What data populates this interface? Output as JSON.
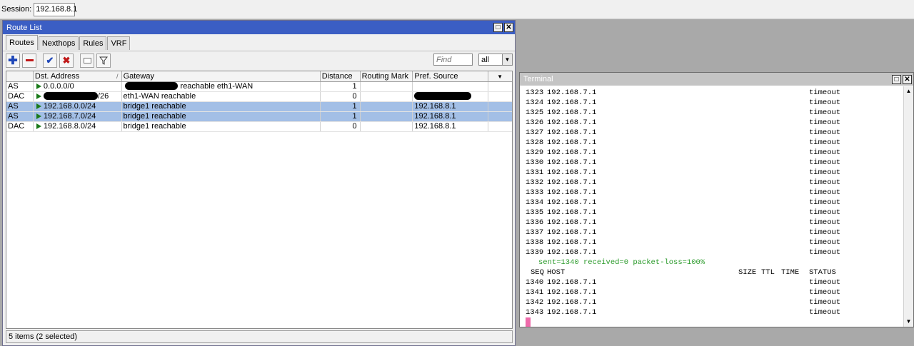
{
  "session": {
    "label": "Session:",
    "value": "192.168.8.1"
  },
  "route_window": {
    "title": "Route List",
    "tabs": [
      "Routes",
      "Nexthops",
      "Rules",
      "VRF"
    ],
    "find_placeholder": "Find",
    "filter_value": "all",
    "columns": [
      "Dst. Address",
      "Gateway",
      "Distance",
      "Routing Mark",
      "Pref. Source"
    ],
    "rows": [
      {
        "flags": "AS",
        "dst": "0.0.0.0/0",
        "gateway": "reachable eth1-WAN",
        "distance": "1",
        "mark": "",
        "pref": "",
        "selected": false
      },
      {
        "flags": "DAC",
        "dst": "/26",
        "gateway": "eth1-WAN reachable",
        "distance": "0",
        "mark": "",
        "pref": "",
        "selected": false
      },
      {
        "flags": "AS",
        "dst": "192.168.0.0/24",
        "gateway": "bridge1 reachable",
        "distance": "1",
        "mark": "",
        "pref": "192.168.8.1",
        "selected": true
      },
      {
        "flags": "AS",
        "dst": "192.168.7.0/24",
        "gateway": "bridge1 reachable",
        "distance": "1",
        "mark": "",
        "pref": "192.168.8.1",
        "selected": true
      },
      {
        "flags": "DAC",
        "dst": "192.168.8.0/24",
        "gateway": "bridge1 reachable",
        "distance": "0",
        "mark": "",
        "pref": "192.168.8.1",
        "selected": false
      }
    ],
    "status": "5 items (2 selected)"
  },
  "terminal": {
    "title": "Terminal",
    "lines_before": [
      {
        "seq": "1323",
        "host": "192.168.7.1",
        "status": "timeout"
      },
      {
        "seq": "1324",
        "host": "192.168.7.1",
        "status": "timeout"
      },
      {
        "seq": "1325",
        "host": "192.168.7.1",
        "status": "timeout"
      },
      {
        "seq": "1326",
        "host": "192.168.7.1",
        "status": "timeout"
      },
      {
        "seq": "1327",
        "host": "192.168.7.1",
        "status": "timeout"
      },
      {
        "seq": "1328",
        "host": "192.168.7.1",
        "status": "timeout"
      },
      {
        "seq": "1329",
        "host": "192.168.7.1",
        "status": "timeout"
      },
      {
        "seq": "1330",
        "host": "192.168.7.1",
        "status": "timeout"
      },
      {
        "seq": "1331",
        "host": "192.168.7.1",
        "status": "timeout"
      },
      {
        "seq": "1332",
        "host": "192.168.7.1",
        "status": "timeout"
      },
      {
        "seq": "1333",
        "host": "192.168.7.1",
        "status": "timeout"
      },
      {
        "seq": "1334",
        "host": "192.168.7.1",
        "status": "timeout"
      },
      {
        "seq": "1335",
        "host": "192.168.7.1",
        "status": "timeout"
      },
      {
        "seq": "1336",
        "host": "192.168.7.1",
        "status": "timeout"
      },
      {
        "seq": "1337",
        "host": "192.168.7.1",
        "status": "timeout"
      },
      {
        "seq": "1338",
        "host": "192.168.7.1",
        "status": "timeout"
      },
      {
        "seq": "1339",
        "host": "192.168.7.1",
        "status": "timeout"
      }
    ],
    "summary": "sent=1340 received=0 packet-loss=100%",
    "header": {
      "seq": "SEQ",
      "host": "HOST",
      "size": "SIZE",
      "ttl": "TTL",
      "time": "TIME",
      "status": "STATUS"
    },
    "lines_after": [
      {
        "seq": "1340",
        "host": "192.168.7.1",
        "status": "timeout"
      },
      {
        "seq": "1341",
        "host": "192.168.7.1",
        "status": "timeout"
      },
      {
        "seq": "1342",
        "host": "192.168.7.1",
        "status": "timeout"
      },
      {
        "seq": "1343",
        "host": "192.168.7.1",
        "status": "timeout"
      }
    ]
  },
  "colors": {
    "title_active": "#3b5ec4",
    "selection": "#a3bfe6",
    "summary_green": "#2a9a2a",
    "cursor": "#ee6aaa"
  }
}
